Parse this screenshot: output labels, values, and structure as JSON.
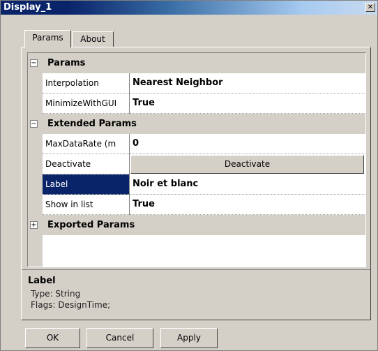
{
  "window": {
    "title": "Display_1",
    "close_glyph": "✕"
  },
  "tabs": [
    {
      "label": "Params",
      "active": true
    },
    {
      "label": "About",
      "active": false
    }
  ],
  "grid": {
    "categories": [
      {
        "label": "Params",
        "expander": "−",
        "expanded": true,
        "rows": [
          {
            "name": "Interpolation",
            "value": "Nearest Neighbor"
          },
          {
            "name": "MinimizeWithGUI",
            "value": "True"
          }
        ]
      },
      {
        "label": "Extended Params",
        "expander": "−",
        "expanded": true,
        "rows": [
          {
            "name": "MaxDataRate (m",
            "value": "0"
          },
          {
            "name": "Deactivate",
            "button": "Deactivate"
          },
          {
            "name": "Label",
            "value": "Noir et blanc",
            "selected": true
          },
          {
            "name": "Show in list",
            "value": "True"
          }
        ]
      },
      {
        "label": "Exported Params",
        "expander": "+",
        "expanded": false,
        "rows": []
      }
    ]
  },
  "description": {
    "title": "Label",
    "type_line": "Type: String",
    "flags_line": "Flags: DesignTime;"
  },
  "buttons": {
    "ok": "OK",
    "cancel": "Cancel",
    "apply": "Apply"
  },
  "icons": {
    "close": "close-icon",
    "collapse": "minus-box-icon",
    "expand": "plus-box-icon"
  },
  "colors": {
    "selection": "#0a246a",
    "face": "#d4d0c8",
    "title_start": "#0a246a"
  }
}
